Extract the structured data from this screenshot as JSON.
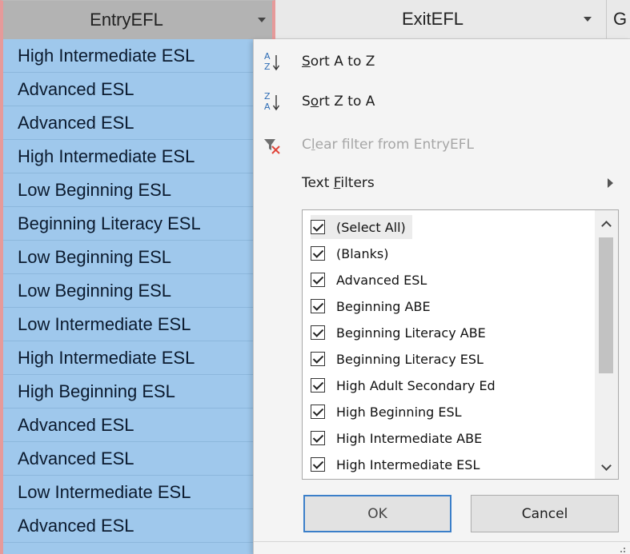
{
  "headers": {
    "entry": "EntryEFL",
    "exit": "ExitEFL",
    "next": "G"
  },
  "cells": [
    "High Intermediate ESL",
    "Advanced ESL",
    "Advanced ESL",
    "High Intermediate ESL",
    "Low Beginning ESL",
    "Beginning Literacy ESL",
    "Low Beginning ESL",
    "Low Beginning ESL",
    "Low Intermediate ESL",
    "High Intermediate ESL",
    "High Beginning ESL",
    "Advanced ESL",
    "Advanced ESL",
    "Low Intermediate ESL",
    "Advanced ESL"
  ],
  "menu": {
    "sort_az": {
      "pre": "",
      "u": "S",
      "post": "ort A to Z"
    },
    "sort_za": {
      "pre": "S",
      "u": "o",
      "post": "rt Z to A"
    },
    "clear_filter": {
      "pre": "C",
      "u": "l",
      "post": "ear filter from EntryEFL"
    },
    "text_filters": {
      "pre": "Text ",
      "u": "F",
      "post": "ilters"
    }
  },
  "filter_items": [
    {
      "label": "(Select All)",
      "checked": true
    },
    {
      "label": "(Blanks)",
      "checked": true
    },
    {
      "label": "Advanced ESL",
      "checked": true
    },
    {
      "label": "Beginning ABE",
      "checked": true
    },
    {
      "label": "Beginning Literacy ABE",
      "checked": true
    },
    {
      "label": "Beginning Literacy ESL",
      "checked": true
    },
    {
      "label": "High Adult Secondary Ed",
      "checked": true
    },
    {
      "label": "High Beginning ESL",
      "checked": true
    },
    {
      "label": "High Intermediate ABE",
      "checked": true
    },
    {
      "label": "High Intermediate ESL",
      "checked": true
    }
  ],
  "buttons": {
    "ok": "OK",
    "cancel": "Cancel"
  },
  "colors": {
    "selected_column": "#9fc8ec",
    "column_border": "#e69a9a",
    "ok_border": "#3b7fc9",
    "clear_filter_icon": "#e0463b"
  }
}
